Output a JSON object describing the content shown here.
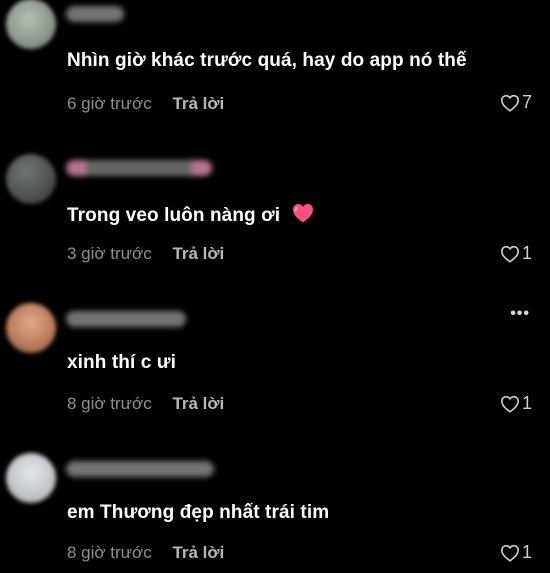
{
  "comments": [
    {
      "text": "Nhìn giờ khác trước quá, hay do app nó thế",
      "time": "6 giờ trước",
      "reply_label": "Trả lời",
      "likes": "7",
      "avatar_color": "#9aa69a",
      "username_color": "#9a9a9a"
    },
    {
      "text": "Trong veo luôn nàng ơi",
      "emoji": "heart-emoji",
      "time": "3 giờ trước",
      "reply_label": "Trả lời",
      "likes": "1",
      "avatar_color": "#4f5553",
      "username_color": "#e8b4c8"
    },
    {
      "text": "xinh thí c ưi",
      "time": "8 giờ trước",
      "reply_label": "Trả lời",
      "likes": "1",
      "avatar_color": "#c98e6e",
      "username_color": "#9a9a9a"
    },
    {
      "text": "em Thương đẹp nhất trái tim",
      "time": "8 giờ trước",
      "reply_label": "Trả lời",
      "likes": "1",
      "avatar_color": "#c9cdd1",
      "username_color": "#9a9a9a"
    }
  ],
  "more_label": "•••",
  "colors": {
    "background": "#000000",
    "text": "#ffffff",
    "meta": "#8f8f8f",
    "heart_emoji": "#ff4f7b"
  }
}
